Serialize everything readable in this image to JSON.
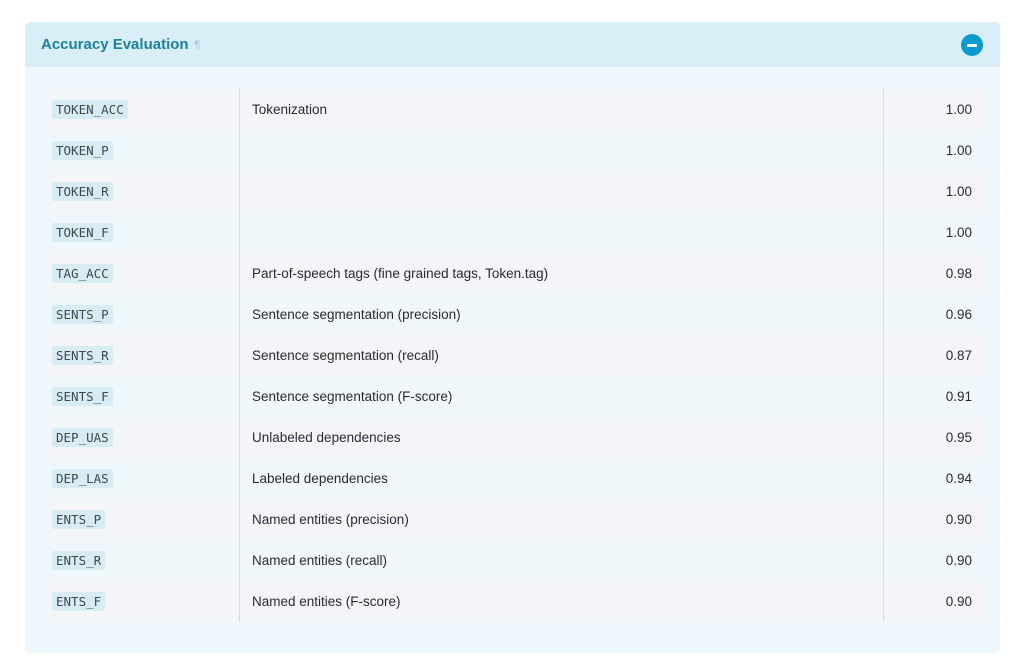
{
  "section": {
    "title": "Accuracy Evaluation",
    "anchor_symbol": "¶",
    "toggle_icon": "minus-circle-icon",
    "colors": {
      "accent": "#099ad0",
      "title": "#1a81a0",
      "header_bg": "#d8eff8",
      "panel_bg": "#eef8fc"
    }
  },
  "table": {
    "rows": [
      {
        "key": "TOKEN_ACC",
        "description": "Tokenization",
        "value": "1.00"
      },
      {
        "key": "TOKEN_P",
        "description": "",
        "value": "1.00"
      },
      {
        "key": "TOKEN_R",
        "description": "",
        "value": "1.00"
      },
      {
        "key": "TOKEN_F",
        "description": "",
        "value": "1.00"
      },
      {
        "key": "TAG_ACC",
        "description": "Part-of-speech tags (fine grained tags, Token.tag)",
        "value": "0.98"
      },
      {
        "key": "SENTS_P",
        "description": "Sentence segmentation (precision)",
        "value": "0.96"
      },
      {
        "key": "SENTS_R",
        "description": "Sentence segmentation (recall)",
        "value": "0.87"
      },
      {
        "key": "SENTS_F",
        "description": "Sentence segmentation (F-score)",
        "value": "0.91"
      },
      {
        "key": "DEP_UAS",
        "description": "Unlabeled dependencies",
        "value": "0.95"
      },
      {
        "key": "DEP_LAS",
        "description": "Labeled dependencies",
        "value": "0.94"
      },
      {
        "key": "ENTS_P",
        "description": "Named entities (precision)",
        "value": "0.90"
      },
      {
        "key": "ENTS_R",
        "description": "Named entities (recall)",
        "value": "0.90"
      },
      {
        "key": "ENTS_F",
        "description": "Named entities (F-score)",
        "value": "0.90"
      }
    ]
  }
}
